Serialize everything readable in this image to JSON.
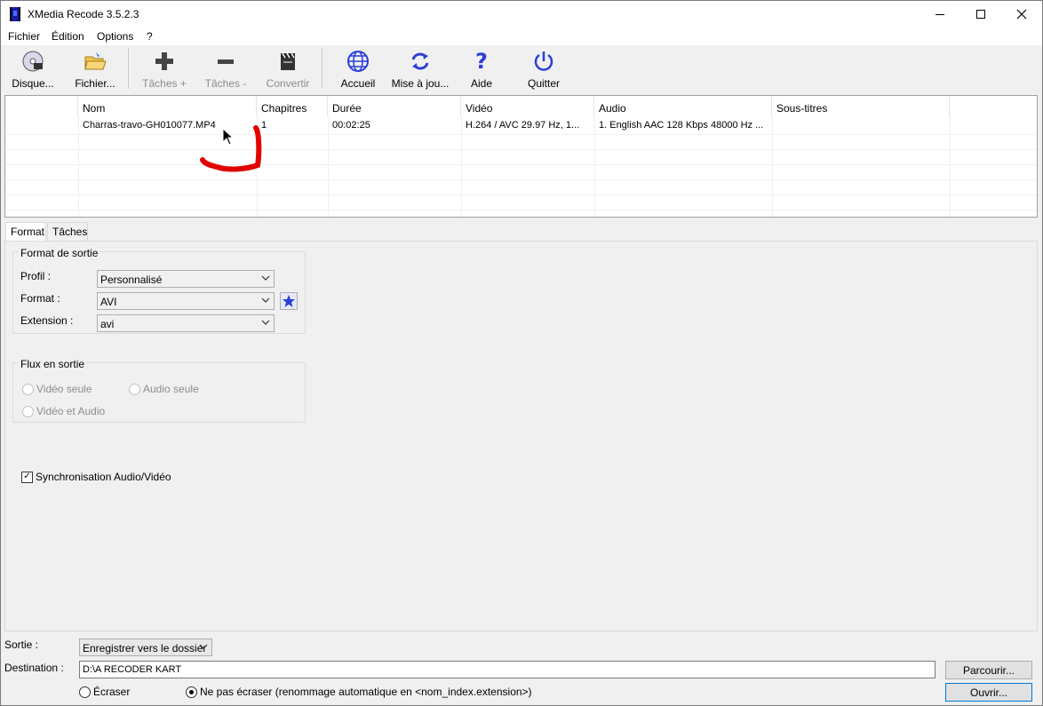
{
  "window": {
    "title": "XMedia Recode 3.5.2.3"
  },
  "menu": [
    "Fichier",
    "Édition",
    "Options",
    "?"
  ],
  "toolbar": {
    "disc": "Disque...",
    "file": "Fichier...",
    "add_task": "Tâches +",
    "remove_task": "Tâches -",
    "convert": "Convertir",
    "home": "Accueil",
    "update": "Mise à jou...",
    "help": "Aide",
    "quit": "Quitter"
  },
  "filelist": {
    "columns": [
      "Nom",
      "Chapitres",
      "Durée",
      "Vidéo",
      "Audio",
      "Sous-titres"
    ],
    "rows": [
      {
        "nom": "Charras-travo-GH010077.MP4",
        "chapitres": "1",
        "duree": "00:02:25",
        "video": "H.264 / AVC  29.97 Hz, 1...",
        "audio": "1. English AAC  128 Kbps 48000 Hz ...",
        "sous_titres": ""
      }
    ]
  },
  "tabs": [
    "Format",
    "Tâches"
  ],
  "format_panel": {
    "group_title": "Format de sortie",
    "profile_label": "Profil :",
    "profile_value": "Personnalisé",
    "format_label": "Format :",
    "format_value": "AVI",
    "extension_label": "Extension :",
    "extension_value": "avi"
  },
  "stream_panel": {
    "group_title": "Flux en sortie",
    "video_only": "Vidéo seule",
    "audio_only": "Audio seule",
    "video_audio": "Vidéo et Audio"
  },
  "sync_label": "Synchronisation Audio/Vidéo",
  "bottom": {
    "output_label": "Sortie :",
    "output_value": "Enregistrer vers le dossier",
    "destination_label": "Destination :",
    "destination_value": "D:\\A RECODER KART",
    "browse_button": "Parcourir...",
    "open_button": "Ouvrir...",
    "overwrite_label": "Écraser",
    "no_overwrite_label": "Ne pas écraser (renommage automatique en <nom_index.extension>)"
  },
  "colors": {
    "accent_blue": "#2b3fd8",
    "annotation_red": "#e00000"
  }
}
